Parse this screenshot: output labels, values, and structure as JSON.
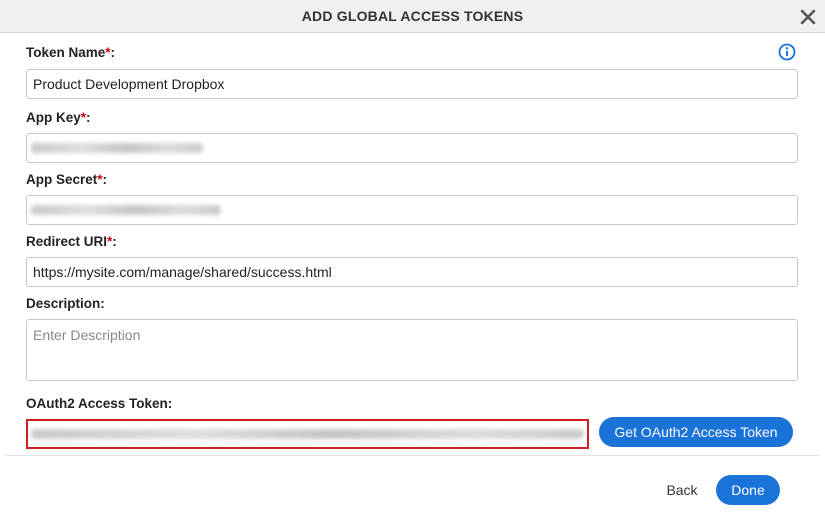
{
  "dialog": {
    "title": "ADD GLOBAL ACCESS TOKENS"
  },
  "icons": {
    "close": "close-icon",
    "info": "info-icon"
  },
  "form": {
    "token_name": {
      "label": "Token Name",
      "required_mark": "*",
      "suffix": ":",
      "value": "Product Development Dropbox"
    },
    "app_key": {
      "label": "App Key",
      "required_mark": "*",
      "suffix": ":"
    },
    "app_secret": {
      "label": "App Secret",
      "required_mark": "*",
      "suffix": ":"
    },
    "redirect_uri": {
      "label": "Redirect URI",
      "required_mark": "*",
      "suffix": ":",
      "value": "https://mysite.com/manage/shared/success.html"
    },
    "description": {
      "label": "Description:",
      "placeholder": "Enter Description"
    },
    "oauth_token": {
      "label": "OAuth2 Access Token:"
    }
  },
  "buttons": {
    "get_token": "Get OAuth2 Access Token",
    "back": "Back",
    "done": "Done"
  },
  "colors": {
    "primary": "#1a73d9",
    "required": "#d0021b",
    "highlight_border": "#cc1f1f"
  }
}
